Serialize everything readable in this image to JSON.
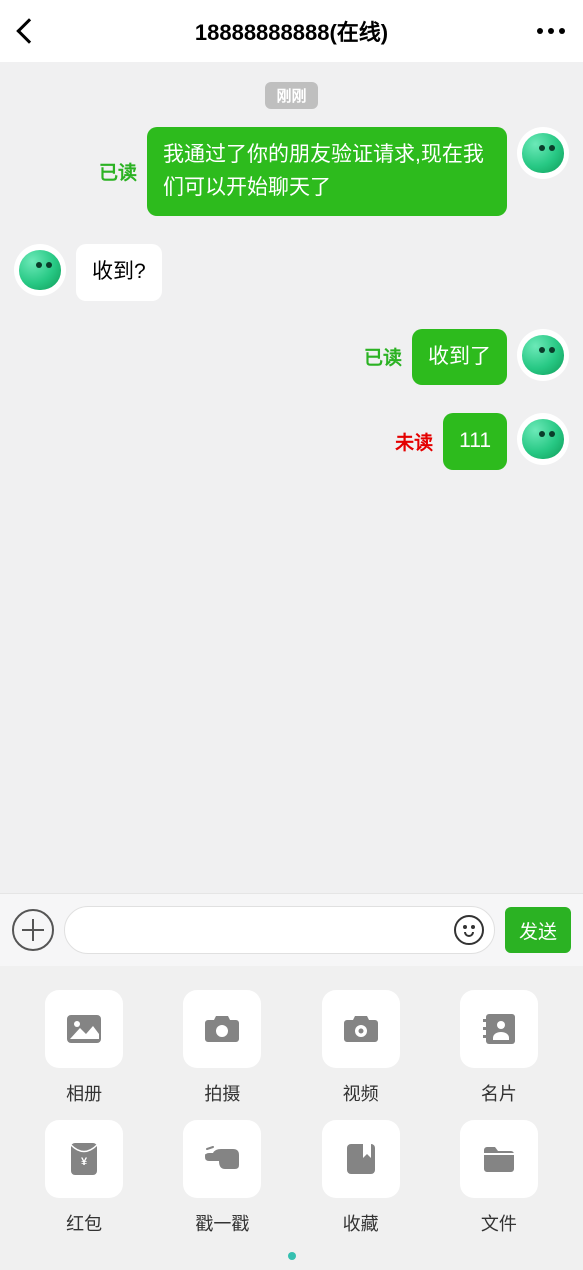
{
  "header": {
    "title": "18888888888(在线)"
  },
  "timestamp": "刚刚",
  "status_labels": {
    "read": "已读",
    "unread": "未读"
  },
  "messages": [
    {
      "side": "self",
      "status": "read",
      "text": "我通过了你的朋友验证请求,现在我们可以开始聊天了"
    },
    {
      "side": "other",
      "text": "收到?"
    },
    {
      "side": "self",
      "status": "read",
      "text": "收到了"
    },
    {
      "side": "self",
      "status": "unread",
      "text": "111"
    }
  ],
  "input": {
    "send_label": "发送"
  },
  "actions": {
    "album": "相册",
    "shoot": "拍摄",
    "video": "视频",
    "card": "名片",
    "redpacket": "红包",
    "poke": "戳一戳",
    "favorite": "收藏",
    "file": "文件"
  }
}
